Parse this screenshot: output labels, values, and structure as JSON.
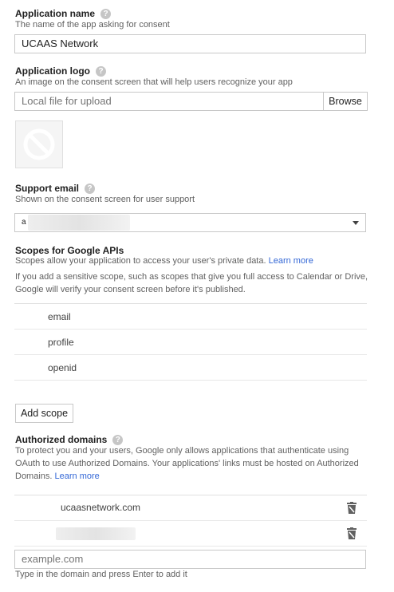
{
  "app_name": {
    "label": "Application name",
    "description": "The name of the app asking for consent",
    "value": "UCAAS Network"
  },
  "app_logo": {
    "label": "Application logo",
    "description": "An image on the consent screen that will help users recognize your app",
    "placeholder": "Local file for upload",
    "browse_label": "Browse"
  },
  "support_email": {
    "label": "Support email",
    "description": "Shown on the consent screen for user support",
    "value_prefix": "a"
  },
  "scopes": {
    "label": "Scopes for Google APIs",
    "description": "Scopes allow your application to access your user's private data.",
    "learn_more": "Learn more",
    "note": "If you add a sensitive scope, such as scopes that give you full access to Calendar or Drive, Google will verify your consent screen before it's published.",
    "items": [
      "email",
      "profile",
      "openid"
    ],
    "add_button": "Add scope"
  },
  "authorized_domains": {
    "label": "Authorized domains",
    "description": "To protect you and your users, Google only allows applications that authenticate using OAuth to use Authorized Domains. Your applications' links must be hosted on Authorized Domains.",
    "learn_more": "Learn more",
    "items": [
      "ucaasnetwork.com"
    ],
    "input_placeholder": "example.com",
    "hint": "Type in the domain and press Enter to add it"
  },
  "icons": {
    "help": "question-icon",
    "trash": "trash-icon",
    "dropdown": "caret-down-icon",
    "logo": "no-image-icon"
  }
}
